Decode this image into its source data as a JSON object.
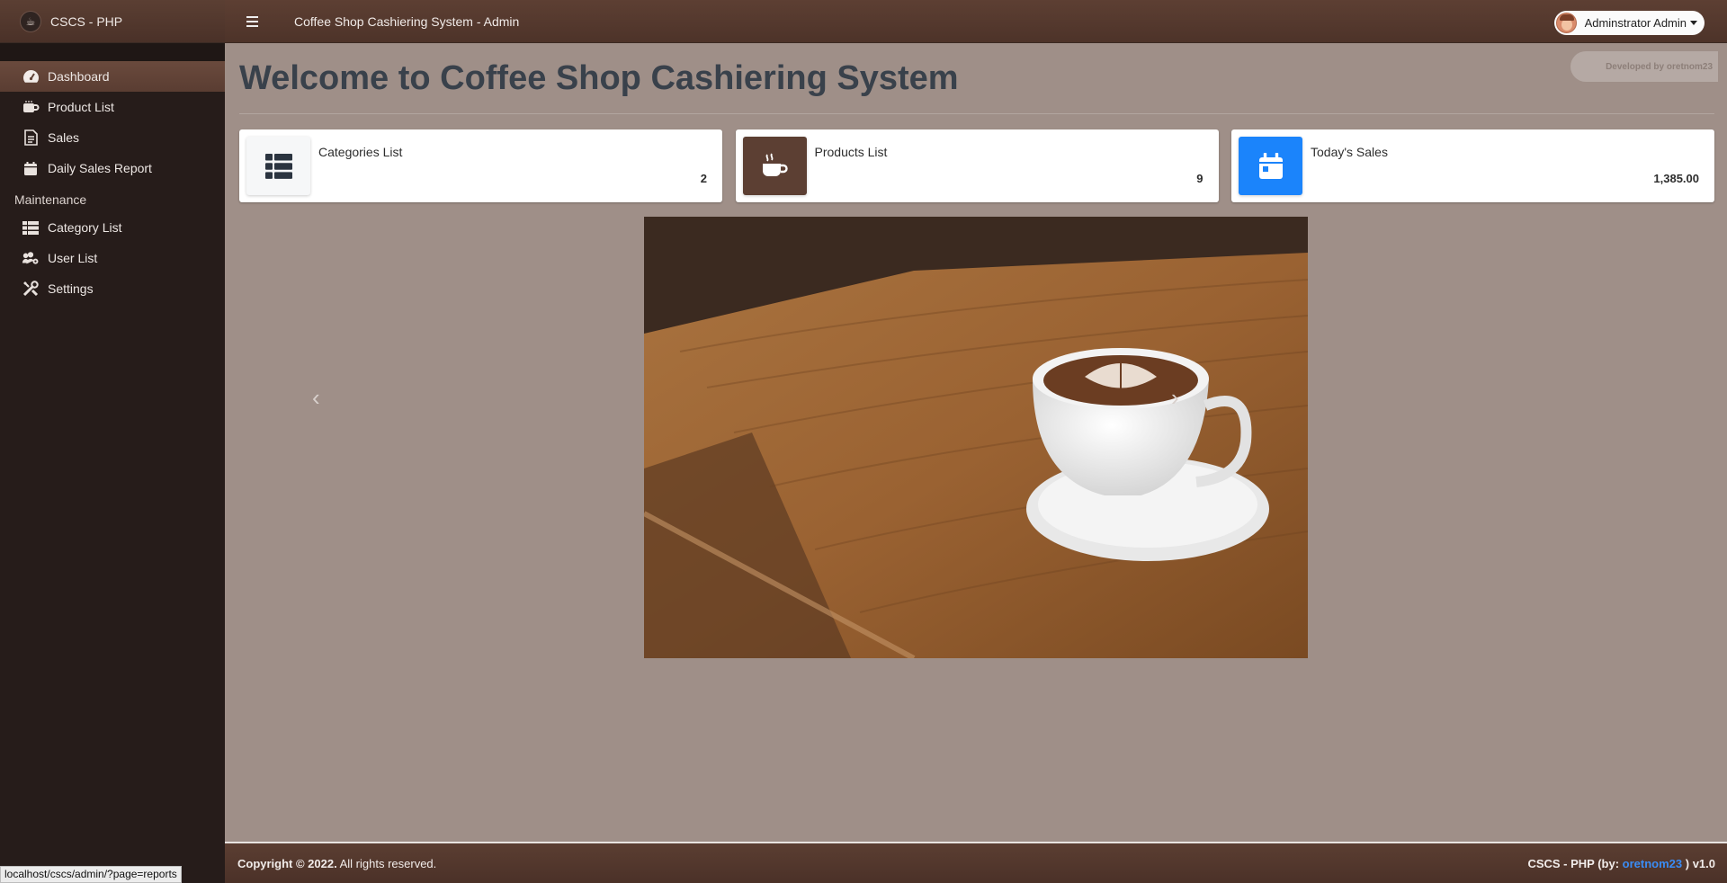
{
  "brand": {
    "title": "CSCS - PHP"
  },
  "topbar": {
    "title": "Coffee Shop Cashiering System - Admin",
    "user_name": "Adminstrator Admin"
  },
  "sidebar": {
    "items": [
      {
        "label": "Dashboard",
        "icon": "tachometer-icon"
      },
      {
        "label": "Product List",
        "icon": "coffee-mug-icon"
      },
      {
        "label": "Sales",
        "icon": "receipt-icon"
      },
      {
        "label": "Daily Sales Report",
        "icon": "calendar-icon"
      }
    ],
    "maintenance_header": "Maintenance",
    "maintenance_items": [
      {
        "label": "Category List",
        "icon": "list-icon"
      },
      {
        "label": "User List",
        "icon": "users-cog-icon"
      },
      {
        "label": "Settings",
        "icon": "tools-icon"
      }
    ]
  },
  "main": {
    "developer_badge": "Developed by oretnom23",
    "page_title": "Welcome to Coffee Shop Cashiering System",
    "cards": [
      {
        "label": "Categories List",
        "value": "2",
        "icon": "th-list-icon"
      },
      {
        "label": "Products List",
        "value": "9",
        "icon": "coffee-icon"
      },
      {
        "label": "Today's Sales",
        "value": "1,385.00",
        "icon": "calendar-day-icon"
      }
    ]
  },
  "footer": {
    "copyright": "Copyright © 2022.",
    "rights": "All rights reserved.",
    "version_prefix": "CSCS - PHP (by: ",
    "author": "oretnom23",
    "version_suffix": " ) v1.0"
  },
  "statusbar": {
    "url": "localhost/cscs/admin/?page=reports"
  },
  "colors": {
    "sidebar_bg": "#261c1a",
    "topbar_bg": "#5d3f33",
    "content_bg": "#9f8f88",
    "accent_blue": "#1b84fb"
  }
}
